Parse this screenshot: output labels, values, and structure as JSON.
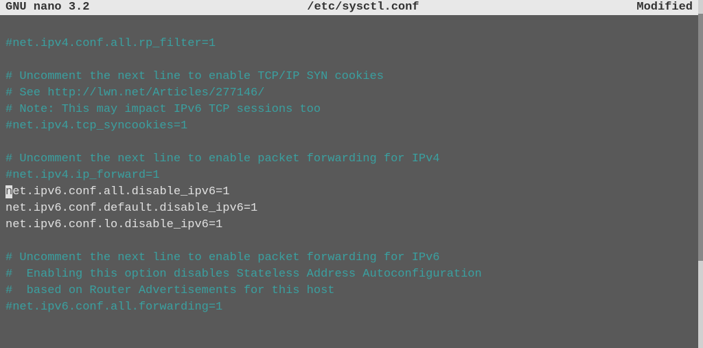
{
  "titlebar": {
    "app": "GNU nano 3.2",
    "filename": "/etc/sysctl.conf",
    "status": "Modified"
  },
  "lines": [
    {
      "cls": "blank",
      "text": ""
    },
    {
      "cls": "comment",
      "text": "#net.ipv4.conf.all.rp_filter=1"
    },
    {
      "cls": "blank",
      "text": ""
    },
    {
      "cls": "comment",
      "text": "# Uncomment the next line to enable TCP/IP SYN cookies"
    },
    {
      "cls": "comment",
      "text": "# See http://lwn.net/Articles/277146/"
    },
    {
      "cls": "comment",
      "text": "# Note: This may impact IPv6 TCP sessions too"
    },
    {
      "cls": "comment",
      "text": "#net.ipv4.tcp_syncookies=1"
    },
    {
      "cls": "blank",
      "text": ""
    },
    {
      "cls": "comment",
      "text": "# Uncomment the next line to enable packet forwarding for IPv4"
    },
    {
      "cls": "comment",
      "text": "#net.ipv4.ip_forward=1"
    },
    {
      "cls": "plain",
      "cursor_at": 0,
      "text": "net.ipv6.conf.all.disable_ipv6=1"
    },
    {
      "cls": "plain",
      "text": "net.ipv6.conf.default.disable_ipv6=1"
    },
    {
      "cls": "plain",
      "text": "net.ipv6.conf.lo.disable_ipv6=1"
    },
    {
      "cls": "blank",
      "text": ""
    },
    {
      "cls": "comment",
      "text": "# Uncomment the next line to enable packet forwarding for IPv6"
    },
    {
      "cls": "comment",
      "text": "#  Enabling this option disables Stateless Address Autoconfiguration"
    },
    {
      "cls": "comment",
      "text": "#  based on Router Advertisements for this host"
    },
    {
      "cls": "comment",
      "text": "#net.ipv6.conf.all.forwarding=1"
    },
    {
      "cls": "blank",
      "text": ""
    }
  ]
}
